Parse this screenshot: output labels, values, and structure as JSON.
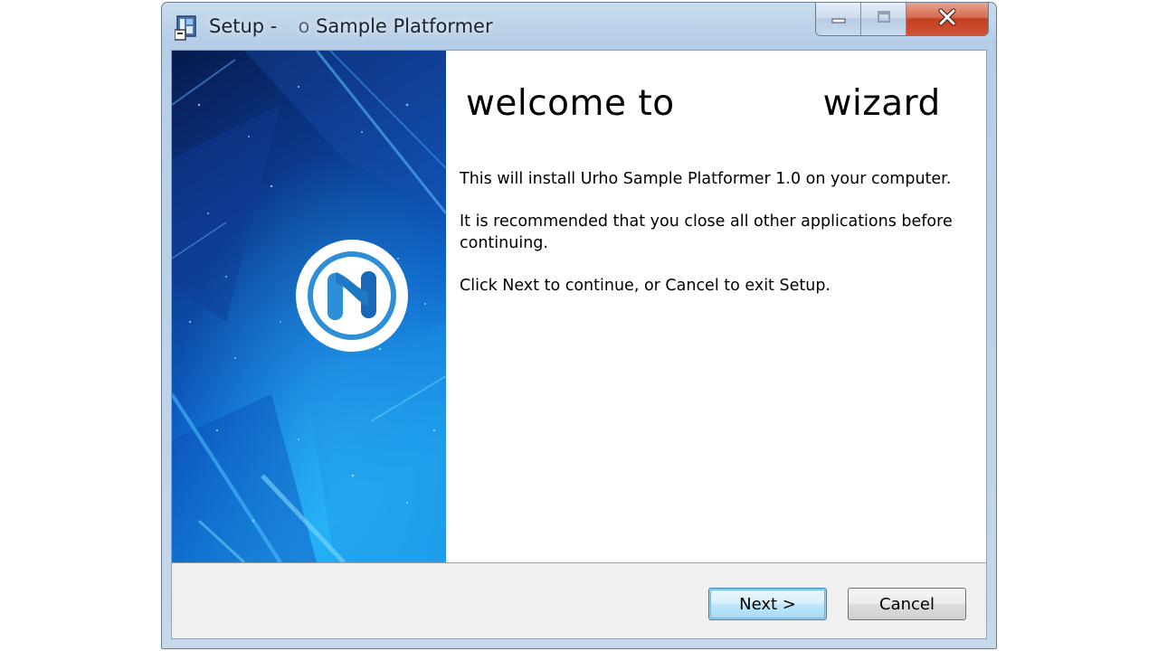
{
  "window": {
    "title_prefix": "Setup -",
    "title_fragment": "o",
    "title_suffix": "Sample Platformer",
    "icon": "installer-icon"
  },
  "caption_buttons": {
    "minimize_icon": "minimize-icon",
    "maximize_icon": "maximize-icon",
    "close_icon": "close-icon"
  },
  "banner": {
    "logo_icon": "h-logo-icon",
    "background_colors": [
      "#0a2b73",
      "#0e5fc4",
      "#1aa6f0"
    ]
  },
  "content": {
    "heading_part1": "welcome to",
    "heading_part2": "wizard",
    "paragraph1": "This will install Urho Sample Platformer 1.0 on your computer.",
    "paragraph2": "It is recommended that you close all other applications before continuing.",
    "paragraph3": "Click Next to continue, or Cancel to exit Setup."
  },
  "buttons": {
    "next_label": "Next >",
    "cancel_label": "Cancel"
  },
  "colors": {
    "accent": "#3c7fb1",
    "close_button": "#c2401f"
  }
}
